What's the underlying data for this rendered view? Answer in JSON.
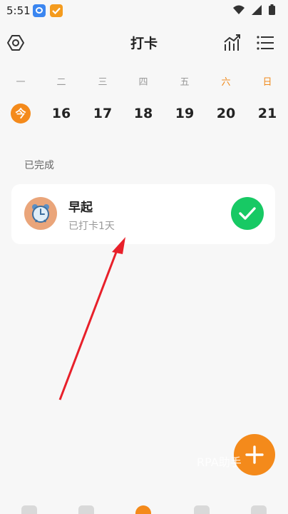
{
  "status_bar": {
    "time": "5:51"
  },
  "header": {
    "title": "打卡"
  },
  "calendar": {
    "weekdays": [
      "一",
      "二",
      "三",
      "四",
      "五",
      "六",
      "日"
    ],
    "today_label": "今",
    "dates": [
      "16",
      "17",
      "18",
      "19",
      "20",
      "21"
    ]
  },
  "section": {
    "completed_label": "已完成"
  },
  "habit": {
    "name": "早起",
    "status": "已打卡1天",
    "checked": true,
    "icon": "alarm-clock-icon"
  },
  "watermark": {
    "text": "RPA助手"
  },
  "colors": {
    "accent": "#f48a1b",
    "success": "#17c964",
    "annotation": "#e8202a"
  }
}
